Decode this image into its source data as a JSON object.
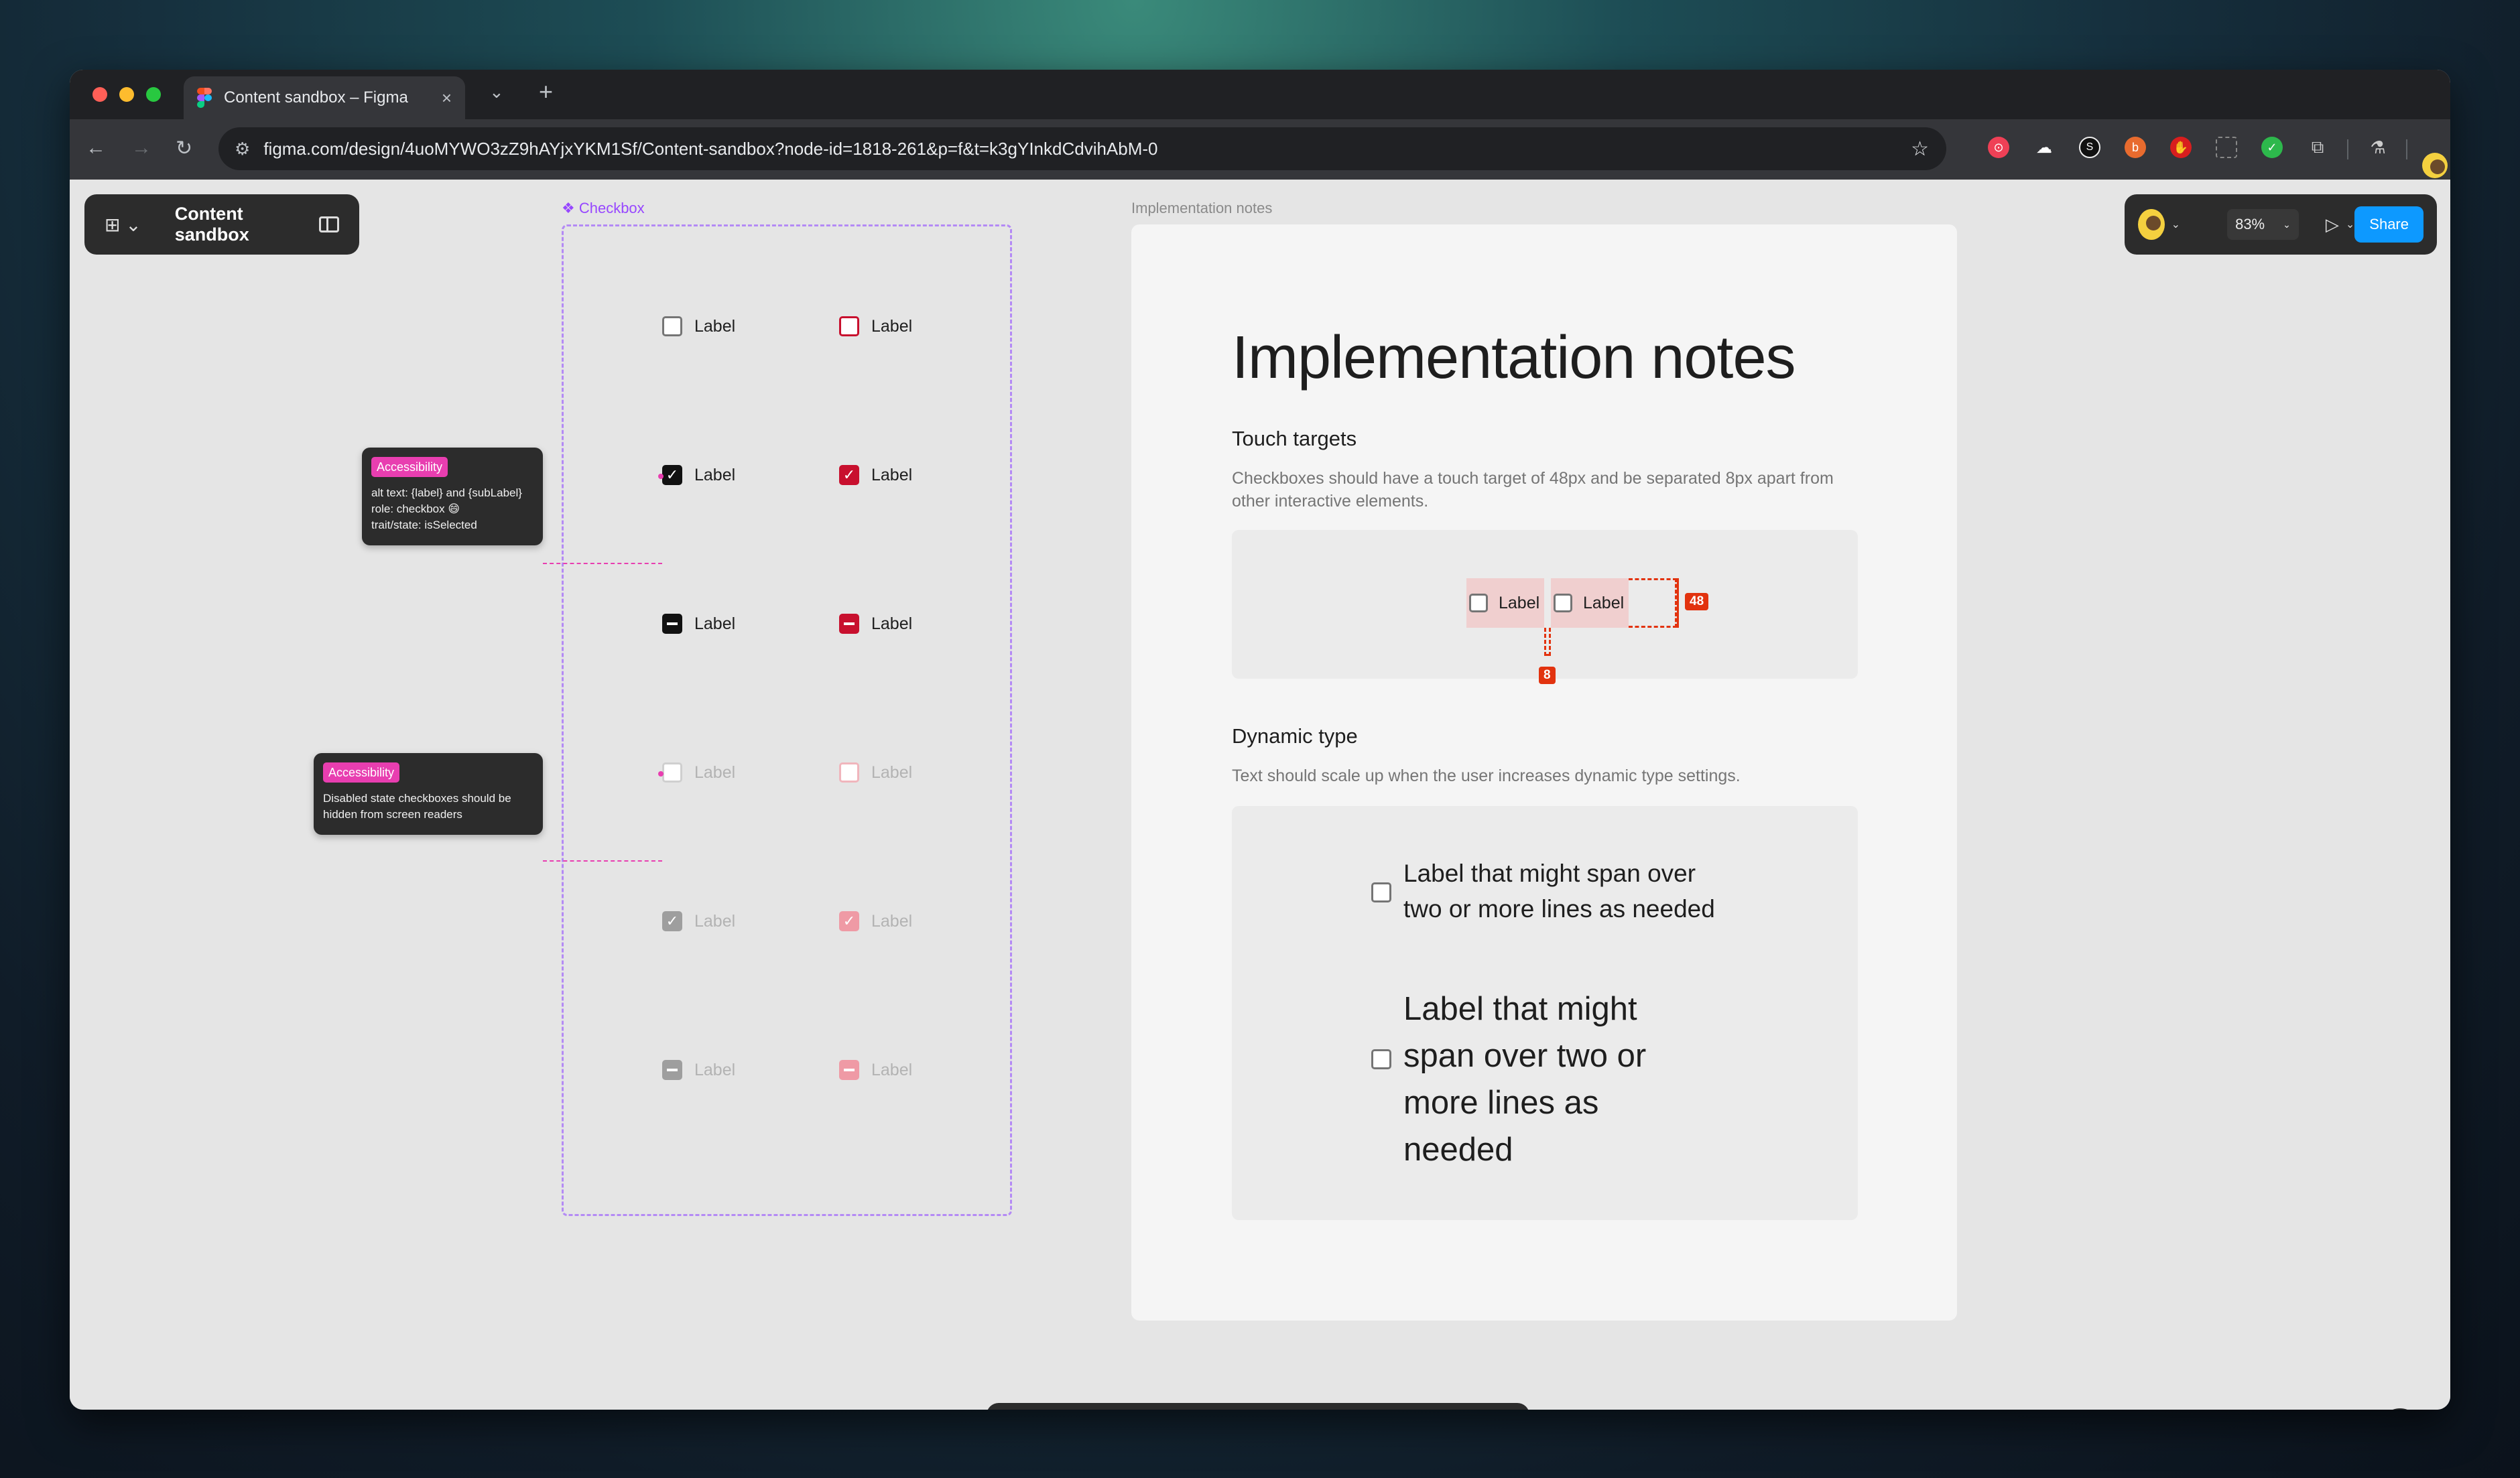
{
  "browser": {
    "tab_title": "Content sandbox – Figma",
    "url": "figma.com/design/4uoMYWO3zZ9hAYjxYKM1Sf/Content-sandbox?node-id=1818-261&p=f&t=k3gYInkdCdvihAbM-0"
  },
  "file": {
    "name": "Content sandbox"
  },
  "right_panel": {
    "zoom": "83%",
    "share_label": "Share"
  },
  "component_frame": {
    "label": "❖ Checkbox",
    "rows": [
      {
        "left_label": "Label",
        "right_label": "Label",
        "state": "unchecked"
      },
      {
        "left_label": "Label",
        "right_label": "Label",
        "state": "checked"
      },
      {
        "left_label": "Label",
        "right_label": "Label",
        "state": "indeterminate"
      },
      {
        "left_label": "Label",
        "right_label": "Label",
        "state": "disabled-unchecked"
      },
      {
        "left_label": "Label",
        "right_label": "Label",
        "state": "disabled-checked"
      },
      {
        "left_label": "Label",
        "right_label": "Label",
        "state": "disabled-indeterminate"
      }
    ]
  },
  "a11y_notes": [
    {
      "badge": "Accessibility",
      "lines": [
        "alt text: {label} and {subLabel}",
        "role: checkbox 😄",
        "trait/state: isSelected"
      ]
    },
    {
      "badge": "Accessibility",
      "lines": [
        "Disabled state checkboxes should be",
        "hidden from screen readers"
      ]
    }
  ],
  "notes": {
    "frame_label": "Implementation notes",
    "title": "Implementation notes",
    "touch": {
      "heading": "Touch targets",
      "desc": "Checkboxes should have a touch target of 48px and be separated 8px apart from other interactive elements.",
      "label_a": "Label",
      "label_b": "Label",
      "size_marker": "48",
      "gap_marker": "8"
    },
    "dynamic": {
      "heading": "Dynamic type",
      "desc": "Text should scale up when the user increases dynamic type settings.",
      "label_small": "Label that might span over two or more lines as needed",
      "label_large": "Label that might span over two or more lines as needed"
    }
  },
  "colors": {
    "accent": "#0d99ff",
    "danger": "#c8102e",
    "a11y": "#e83eb0",
    "frame": "#9747ff",
    "marker": "#e2330f"
  }
}
